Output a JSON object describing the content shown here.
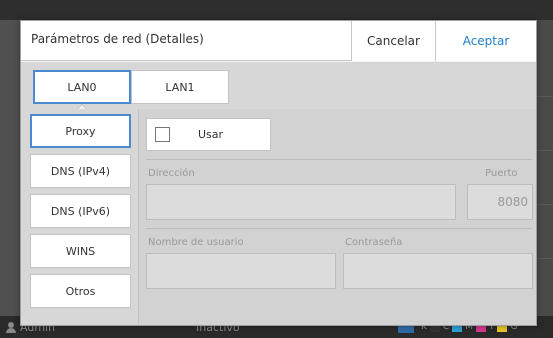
{
  "background": {
    "status_user": "Admin",
    "status_state": "Inactivo",
    "ink_labels": [
      "K",
      "C",
      "M",
      "Y",
      "G"
    ],
    "ink_colors": [
      "#333333",
      "#2aa3d8",
      "#d63a8e",
      "#e7c928",
      "#6a6a6a"
    ]
  },
  "dialog": {
    "title": "Parámetros de red (Detalles)",
    "cancel_label": "Cancelar",
    "accept_label": "Aceptar",
    "accent_color": "#1e7ec8"
  },
  "tabs": [
    {
      "label": "LAN0",
      "selected": true
    },
    {
      "label": "LAN1",
      "selected": false
    }
  ],
  "side_menu": [
    {
      "label": "Proxy",
      "selected": true
    },
    {
      "label": "DNS (IPv4)",
      "selected": false
    },
    {
      "label": "DNS (IPv6)",
      "selected": false
    },
    {
      "label": "WINS",
      "selected": false
    },
    {
      "label": "Otros",
      "selected": false
    }
  ],
  "proxy": {
    "use_label": "Usar",
    "use_checked": false,
    "address_label": "Dirección",
    "address_value": "",
    "port_label": "Puerto",
    "port_value": "8080",
    "username_label": "Nombre de usuario",
    "username_value": "",
    "password_label": "Contraseña",
    "password_value": ""
  }
}
